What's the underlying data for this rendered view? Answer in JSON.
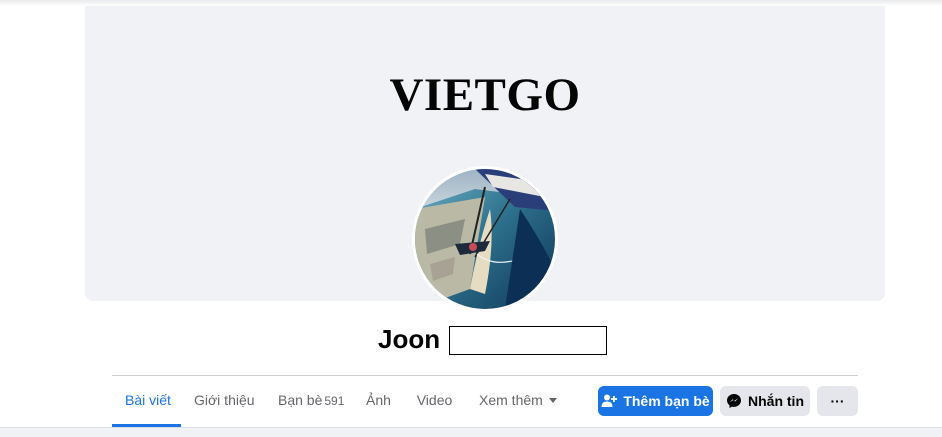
{
  "cover": {
    "title": "VIETGO"
  },
  "profile": {
    "name": "Joon"
  },
  "tabs": [
    {
      "label": "Bài viết",
      "active": true
    },
    {
      "label": "Giới thiệu"
    },
    {
      "label": "Bạn bè",
      "count": "591"
    },
    {
      "label": "Ảnh"
    },
    {
      "label": "Video"
    },
    {
      "label": "Xem thêm"
    }
  ],
  "actions": {
    "add_friend_label": "Thêm bạn bè",
    "message_label": "Nhắn tin",
    "more_label": "···"
  },
  "icons": {
    "add_friend": "add-friend-icon",
    "messenger": "messenger-icon",
    "dropdown": "chevron-down-icon"
  },
  "colors": {
    "accent": "#1b74e4",
    "cover_bg": "#f0f2f5",
    "secondary_button": "#e4e6eb"
  }
}
